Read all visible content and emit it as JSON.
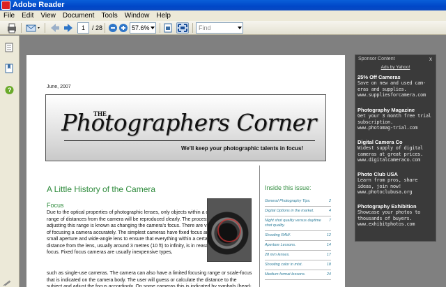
{
  "window": {
    "title": "Adobe Reader"
  },
  "menu": [
    "File",
    "Edit",
    "View",
    "Document",
    "Tools",
    "Window",
    "Help"
  ],
  "toolbar": {
    "page_current": "1",
    "page_total": "/ 28",
    "zoom": "57.6%",
    "find_placeholder": "Find"
  },
  "doc": {
    "date": "June, 2007",
    "masthead_the": "THE",
    "masthead": "Photographers Corner",
    "tagline": "We'll keep your photographic talents in focus!",
    "article_title": "A Little History of the Camera",
    "section_title": "Focus",
    "paragraph1": "Due to the optical properties of photographic lenses, only objects within a certain range of distances from the camera will be reproduced clearly. The process of adjusting this range is known as changing the camera's focus. There are various ways of focusing a camera accurately. The simplest cameras have fixed focus and use a small aperture and wide-angle lens to ensure that everything within a certain range of distance from the lens, usually around 3 metres (10 ft) to infinity, is in reasonable focus. Fixed focus cameras are usually inexpensive types,",
    "paragraph2": "such as single-use cameras. The camera can also have a limited focusing range or scale-focus that is indicated on the camera body. The user will guess or calculate the distance to the subject and adjust the focus accordingly. On some cameras this is indicated by symbols (head-and-shoulders; two people standing upright; one tree; mountains).",
    "inside_title": "Inside this issue:",
    "toc": [
      {
        "label": "General Photography Tips.",
        "page": "2"
      },
      {
        "label": "Digital Options in the market.",
        "page": "4"
      },
      {
        "label": "Night shot quality versus daytime shot quality.",
        "page": "7"
      },
      {
        "label": "Shooting RAW.",
        "page": "12"
      },
      {
        "label": "Aperture Lessons.",
        "page": "14"
      },
      {
        "label": "28 mm lenses.",
        "page": "17"
      },
      {
        "label": "Shooting color in mist.",
        "page": "18"
      },
      {
        "label": "Medium format lessons.",
        "page": "24"
      }
    ]
  },
  "sponsor": {
    "header": "Sponsor Content",
    "close": "x",
    "ads_by": "Ads by Yahoo!",
    "ads": [
      {
        "title": "25% Off Cameras",
        "text": "Save on new and used cam-eras and supplies.",
        "url": "www.suppliesforcamera.com"
      },
      {
        "title": "Photography Magazine",
        "text": "Get your 3 month free trial subscription.",
        "url": "www.photomag-trial.com"
      },
      {
        "title": "Digital Camera Co",
        "text": "Widest supply of digital cameras at great prices.",
        "url": "www.digitalcameraco.com"
      },
      {
        "title": "Photo Club USA",
        "text": "Learn from pros, share ideas, join now!",
        "url": "www.photoclubusa.org"
      },
      {
        "title": "Photography Exhibition",
        "text": "Showcase your photos to thousands of buyers.",
        "url": "www.exhibitphotos.com"
      }
    ]
  }
}
